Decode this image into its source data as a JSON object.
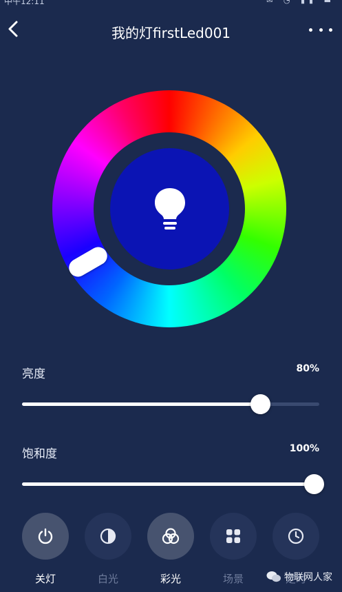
{
  "status_bar": {
    "time": "中午12:11"
  },
  "header": {
    "title": "我的灯firstLed001"
  },
  "color_wheel": {
    "selected_color": "#0b14b4",
    "handle_hue": "blue"
  },
  "brightness": {
    "label": "亮度",
    "value_text": "80%",
    "value": 0.8
  },
  "saturation": {
    "label": "饱和度",
    "value_text": "100%",
    "value": 1.0
  },
  "modes": [
    {
      "label": "关灯",
      "icon": "power-icon",
      "active": true
    },
    {
      "label": "白光",
      "icon": "half-circle-icon",
      "active": false
    },
    {
      "label": "彩光",
      "icon": "rgb-circles-icon",
      "active": true
    },
    {
      "label": "场景",
      "icon": "grid-icon",
      "active": false
    },
    {
      "label": "定时",
      "icon": "clock-icon",
      "active": false
    }
  ],
  "watermark": {
    "text": "物联网人家",
    "icon": "wechat-icon"
  },
  "colors": {
    "background": "#1b2a4e",
    "active_circle": "#47536f",
    "inactive_circle": "#25345a"
  }
}
